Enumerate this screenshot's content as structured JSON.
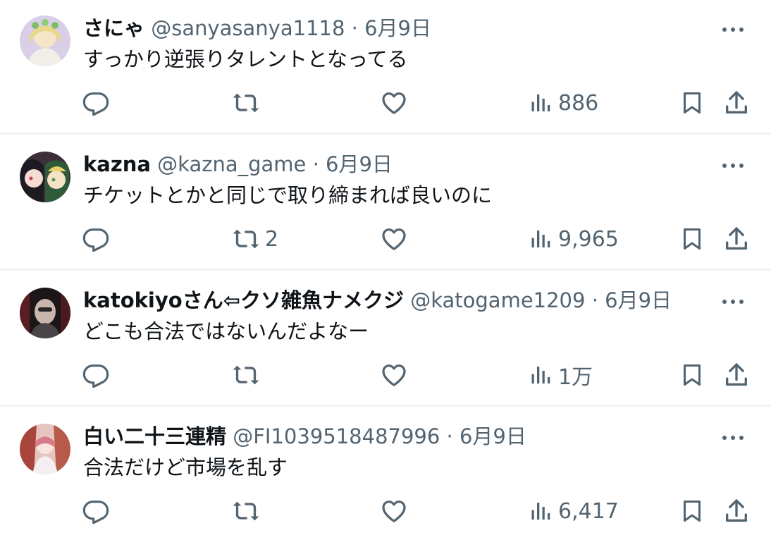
{
  "tweets": [
    {
      "name": "さにゃ",
      "handle": "@sanyasanya1118",
      "date": "6月9日",
      "text": "すっかり逆張りタレントとなってる",
      "retweets": "",
      "views": "886",
      "avatar": "anime-character-avatar"
    },
    {
      "name": "kazna",
      "handle": "@kazna_game",
      "date": "6月9日",
      "text": "チケットとかと同じで取り締まれば良いのに",
      "retweets": "2",
      "views": "9,965",
      "avatar": "anime-character-avatar"
    },
    {
      "name": "katokiyoさん⇦クソ雑魚ナメクジ",
      "handle": "@katogame1209",
      "date": "6月9日",
      "text": "どこも合法ではないんだよなー",
      "retweets": "",
      "views": "1万",
      "avatar": "game-character-avatar"
    },
    {
      "name": "白い二十三連精",
      "handle": "@FI1039518487996",
      "date": "6月9日",
      "text": "合法だけど市場を乱す",
      "retweets": "",
      "views": "6,417",
      "avatar": "anime-character-avatar"
    }
  ],
  "meta_separator": "·",
  "icons": {
    "reply": "reply-icon",
    "retweet": "retweet-icon",
    "like": "like-icon",
    "views": "views-icon",
    "bookmark": "bookmark-icon",
    "share": "share-icon",
    "more": "more-icon"
  },
  "colors": {
    "text": "#0f1419",
    "secondary": "#536471",
    "divider": "#eff3f4"
  }
}
